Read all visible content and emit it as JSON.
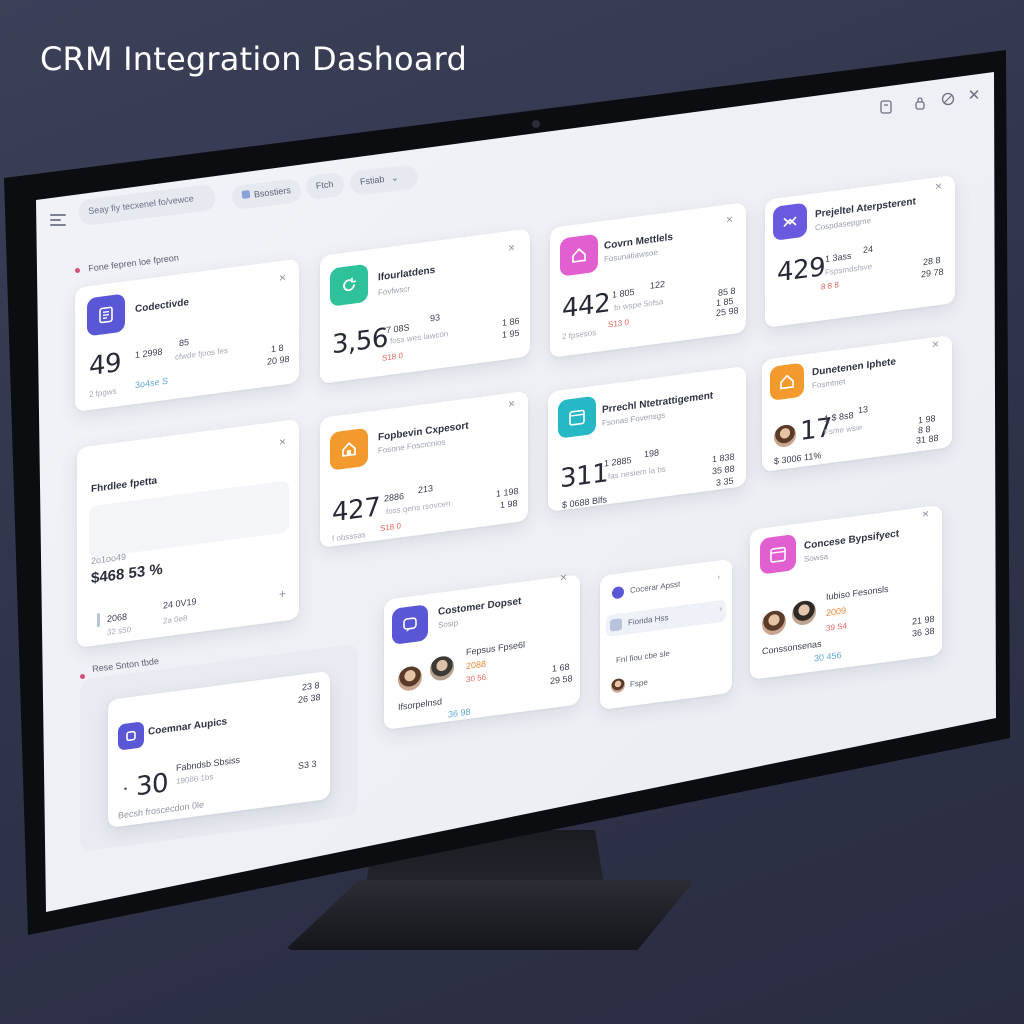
{
  "page_title": "CRM Integration Dashoard",
  "toolbar": {
    "search_placeholder": "Seay fiy tecxenel fo/vewce",
    "chips": [
      "Bsostiers",
      "Ftch",
      "Fstiab"
    ],
    "chip_chevron": "⌄",
    "window_icons": [
      "doc-icon",
      "lock-icon",
      "globe-icon",
      "close-icon"
    ]
  },
  "sections": {
    "left_top": "Fone fepren loe fpreon",
    "left_bottom": "Rese Snton tbde"
  },
  "cards": {
    "c1": {
      "title": "Codectivde",
      "big": "49",
      "s1": "1 2998",
      "s2": "85",
      "faint1": "2 fpgws",
      "blue": "3o4se S",
      "r1": "cfwde fjoos fes",
      "r2": "1 8",
      "r3": "20 98",
      "icon": "document-icon",
      "color": "#5a57d6"
    },
    "c2": {
      "title": "Ifourlatdens",
      "sub": "Fovfwscr",
      "big": "3,56",
      "s1": "7 08S",
      "s2": "93",
      "faint1": "foss wes lawcon",
      "red": "S18 0",
      "r1": "1 86",
      "r2": "1 95",
      "icon": "refresh-icon",
      "color": "#2fc29a"
    },
    "c3": {
      "title": "Covrn Mettlels",
      "sub": "Fosunatiawsoe",
      "big": "442",
      "s1": "1 805",
      "s2": "122",
      "faint1": "fo wspe 5ofsa",
      "faint2": "2 fpsesos",
      "red": "S13 0",
      "r1": "85 8",
      "r2": "1 85",
      "r3": "25 98",
      "icon": "home-icon",
      "color": "#e25fd1"
    },
    "c4": {
      "title": "Prejeltel Aterpsterent",
      "sub": "Cospdasepgme",
      "big": "429",
      "s1": "1 3ass",
      "s2": "24",
      "faint1": "Fspsmdsfsve",
      "red": "8 8 8",
      "r1": "28 8",
      "r2": "29 78",
      "icon": "link-icon",
      "color": "#6a5ae0"
    },
    "c5": {
      "title": "Fhrdlee fpetta",
      "amount_label": "2o1oo49",
      "amount": "$468 53 %",
      "s1": "2068",
      "s2": "24 0V19",
      "faint1": "32 s50",
      "faint2": "2a 0e8",
      "icon": "plus-icon"
    },
    "c6": {
      "title": "Fopbevin Cxpesort",
      "sub": "Fosone Foscrcnios",
      "big": "427",
      "s1": "2886",
      "s2": "213",
      "faint1": "foss qens rsovcen",
      "faint2": "f obsssas",
      "red": "S18 0",
      "r1": "1 198",
      "r2": "1 98",
      "icon": "home-icon",
      "color": "#f29a2e"
    },
    "c7": {
      "title": "Prrechl Ntetrattigement",
      "sub": "Fsonas Fovensgs",
      "big": "311",
      "s1": "1 2885",
      "s2": "198",
      "faint1": "fas nesiem la bs",
      "small": "$ 0688 Blfs",
      "r1": "1 838",
      "r2": "35 88",
      "r3": "3 35",
      "icon": "calendar-icon",
      "color": "#26b8c4"
    },
    "c8": {
      "title": "Dunetenen Iphete",
      "sub": "Fosmtnet",
      "big": "17",
      "s1": "1 $ 8s8",
      "s2": "13",
      "faint1": "Fsme wsie",
      "small": "$ 3006 11%",
      "r1": "1 98",
      "r2": "8 8",
      "r3": "31 88",
      "icon": "home-icon",
      "color": "#f29a2e"
    },
    "c9": {
      "title": "Costomer Dopset",
      "sub": "Sosip",
      "name": "Fepsus Fpse6l",
      "orange": "2088",
      "red": "30 56",
      "footer": "Ifsorpelnsd",
      "blue": "36 98",
      "r1": "1 68",
      "r2": "29 58",
      "icon": "chat-icon",
      "color": "#5a57d6"
    },
    "c10": {
      "title": "Cocerar Apsst",
      "items": [
        "Cocerar Apsst",
        "Fiorida Hss",
        "Fnl fiou cbe sle",
        "Fspe"
      ]
    },
    "c11": {
      "title": "Concese Bypsifyect",
      "sub": "Sowsa",
      "name": "Iubiso Fesonsls",
      "orange": "2009",
      "red": "39 S4",
      "footer": "Conssonsenas",
      "blue": "30 456",
      "r1": "21 98",
      "r2": "36 38",
      "icon": "calendar-icon",
      "color": "#e25fd1"
    },
    "c12": {
      "title": "Coemnar Aupics",
      "big": "30",
      "s1": "Fabndsb Sbsiss",
      "s2": "19086 1bs",
      "footer": "Becsh froscecdon 0le",
      "r1": "23 8",
      "r2": "26 38",
      "r3": "S3 3",
      "icon": "square-icon",
      "color": "#5a57d6"
    }
  },
  "colors": {
    "accent": "#5a57d6",
    "teal": "#2fc29a",
    "pink": "#e25fd1",
    "orange": "#f29a2e",
    "cyan": "#26b8c4"
  }
}
